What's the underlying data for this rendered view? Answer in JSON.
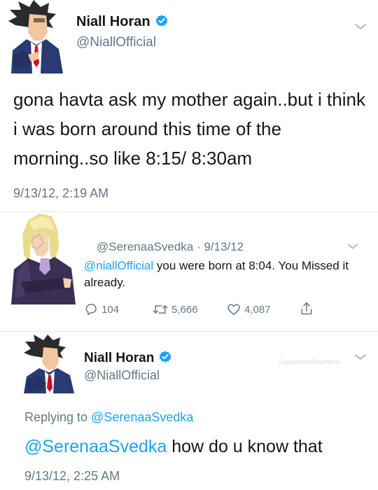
{
  "tweet1": {
    "author_name": "Niall Horan",
    "author_handle": "@NiallOfficial",
    "text": "gona havta ask my mother again..but i think i was born around this time of the morning..so like 8:15/ 8:30am",
    "timestamp": "9/13/12, 2:19 AM"
  },
  "reply_tweet": {
    "author_handle": "@SerenaaSvedka",
    "date": "9/13/12",
    "mention": "@niallOfficial",
    "text": " you were born at 8:04. You Missed it already.",
    "replies": "104",
    "retweets": "5,666",
    "likes": "4,087"
  },
  "tweet2": {
    "author_name": "Niall Horan",
    "author_handle": "@NiallOfficial",
    "replying_to_prefix": "Replying to ",
    "replying_to_handle": "@SerenaaSvedka",
    "mention": "@SerenaaSvedka",
    "text": " how do u know that",
    "timestamp": "9/13/12, 2:25 AM"
  },
  "watermark": "SuppressedReactions",
  "icons": {
    "verified": "verified-badge-icon",
    "chevron": "chevron-down-icon",
    "reply": "reply-icon",
    "retweet": "retweet-icon",
    "like": "heart-icon",
    "share": "share-icon"
  },
  "colors": {
    "link_blue": "#1da1f2",
    "secondary_text": "#657786",
    "primary_text": "#14171a"
  }
}
